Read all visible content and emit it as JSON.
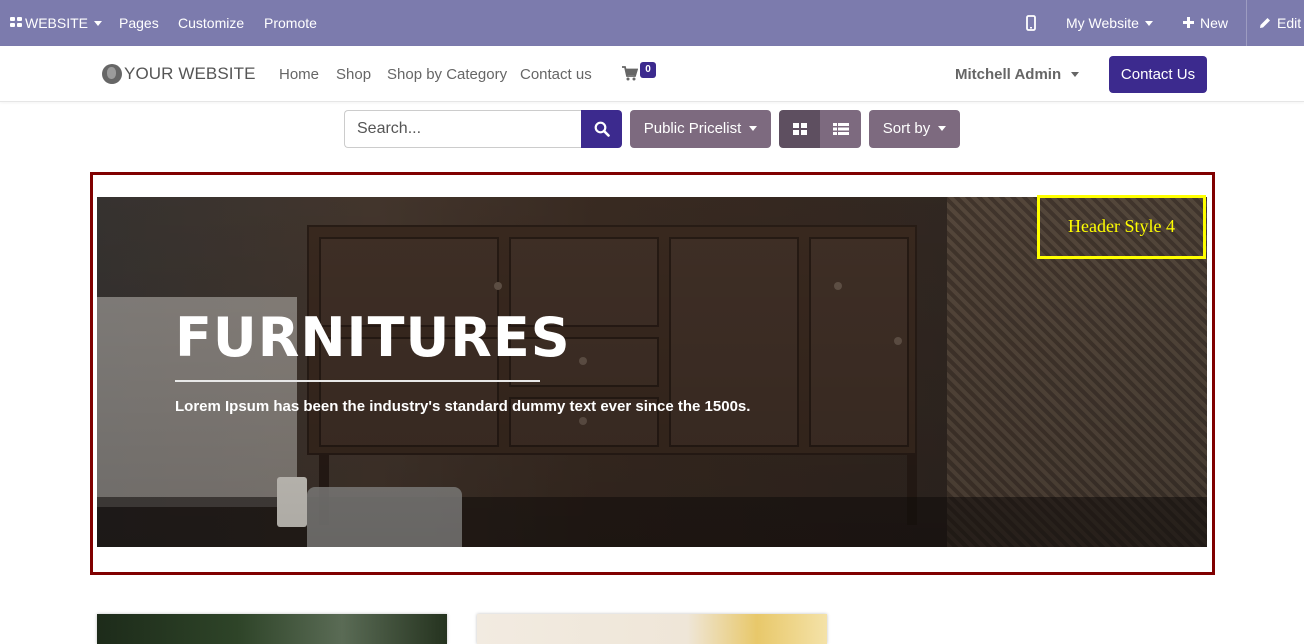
{
  "adminbar": {
    "app_label": "WEBSITE",
    "pages": "Pages",
    "customize": "Customize",
    "promote": "Promote",
    "site_selector": "My Website",
    "new": "New",
    "edit": "Edit",
    "color": "#7c7bad"
  },
  "header": {
    "logo": "YOUR WEBSITE",
    "nav": [
      "Home",
      "Shop",
      "Shop by Category",
      "Contact us"
    ],
    "cart_count": "0",
    "user": "Mitchell Admin",
    "contact_button": "Contact Us",
    "accent": "#3c2a8e"
  },
  "toolbar": {
    "search_placeholder": "Search...",
    "pricelist": "Public Pricelist",
    "sort": "Sort by",
    "button_color": "#7d6a7f"
  },
  "banner": {
    "title": "FURNITURES",
    "subtitle": "Lorem Ipsum has been the industry's standard dummy text ever since the 1500s.",
    "style_label": "Header Style 4",
    "frame_color": "#800000",
    "label_color": "#ffff00"
  },
  "icons": {
    "apps": "grid-icon",
    "mobile": "mobile-icon",
    "new": "plus-icon",
    "edit": "pencil-icon",
    "cart": "cart-icon",
    "search": "search-icon",
    "grid_view": "grid-view-icon",
    "list_view": "list-view-icon",
    "logo": "globe-icon"
  }
}
